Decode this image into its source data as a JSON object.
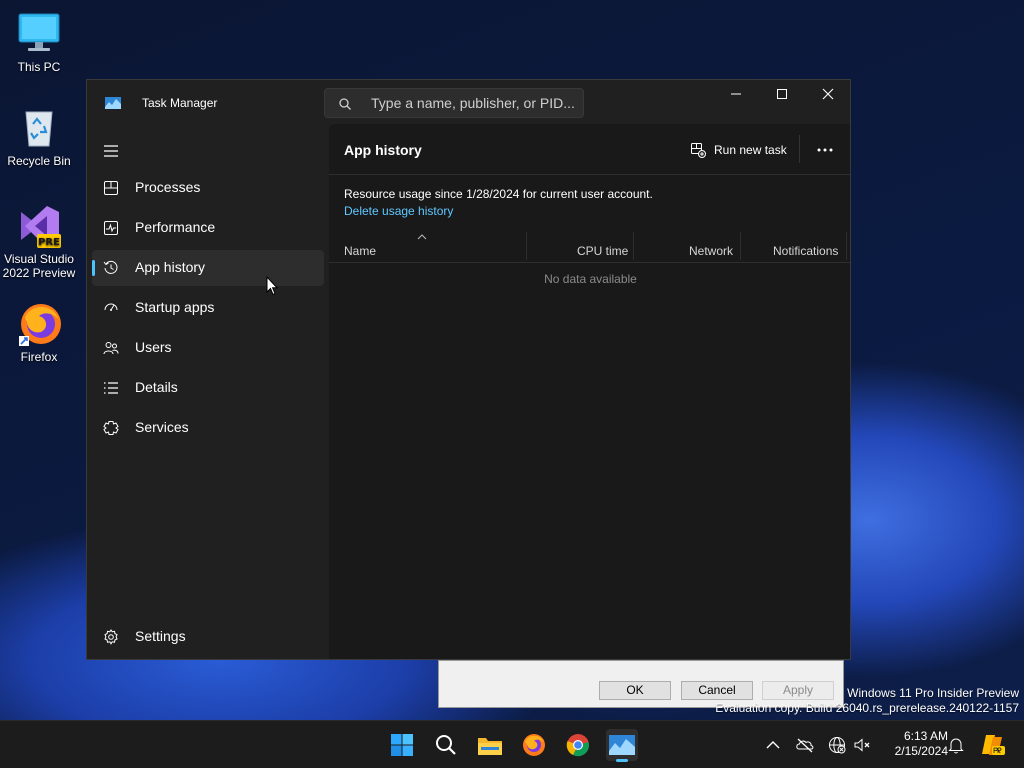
{
  "desktop": {
    "icons": [
      {
        "label": "This PC",
        "icon": "this-pc-icon"
      },
      {
        "label": "Recycle Bin",
        "icon": "recycle-bin-icon"
      },
      {
        "label": "Visual Studio 2022 Preview",
        "icon": "visual-studio-icon",
        "badge": "PRE"
      },
      {
        "label": "Firefox",
        "icon": "firefox-icon"
      }
    ],
    "watermark": {
      "line1": "Windows 11 Pro Insider Preview",
      "line2": "Evaluation copy. Build 26040.rs_prerelease.240122-1157"
    }
  },
  "background_dialog": {
    "ok": "OK",
    "cancel": "Cancel",
    "apply": "Apply"
  },
  "task_manager": {
    "title": "Task Manager",
    "search_placeholder": "Type a name, publisher, or PID...",
    "nav": [
      {
        "label": "Processes",
        "icon": "processes-icon"
      },
      {
        "label": "Performance",
        "icon": "performance-icon"
      },
      {
        "label": "App history",
        "icon": "app-history-icon",
        "selected": true
      },
      {
        "label": "Startup apps",
        "icon": "startup-apps-icon"
      },
      {
        "label": "Users",
        "icon": "users-icon"
      },
      {
        "label": "Details",
        "icon": "details-icon"
      },
      {
        "label": "Services",
        "icon": "services-icon"
      }
    ],
    "settings_label": "Settings",
    "page": {
      "title": "App history",
      "run_new_task": "Run new task",
      "resource_info": "Resource usage since 1/28/2024 for current user account.",
      "delete_link": "Delete usage history",
      "columns": [
        "Name",
        "CPU time",
        "Network",
        "Notifications"
      ],
      "empty_text": "No data available"
    }
  },
  "taskbar": {
    "apps": [
      "start-icon",
      "search-icon",
      "file-explorer-icon",
      "firefox-icon",
      "chrome-icon",
      "task-manager-icon"
    ],
    "clock": {
      "time": "6:13 AM",
      "date": "2/15/2024"
    }
  },
  "colors": {
    "accent": "#4cc2ff",
    "link": "#60c8ff",
    "surface": "#202020",
    "content": "#191919"
  }
}
